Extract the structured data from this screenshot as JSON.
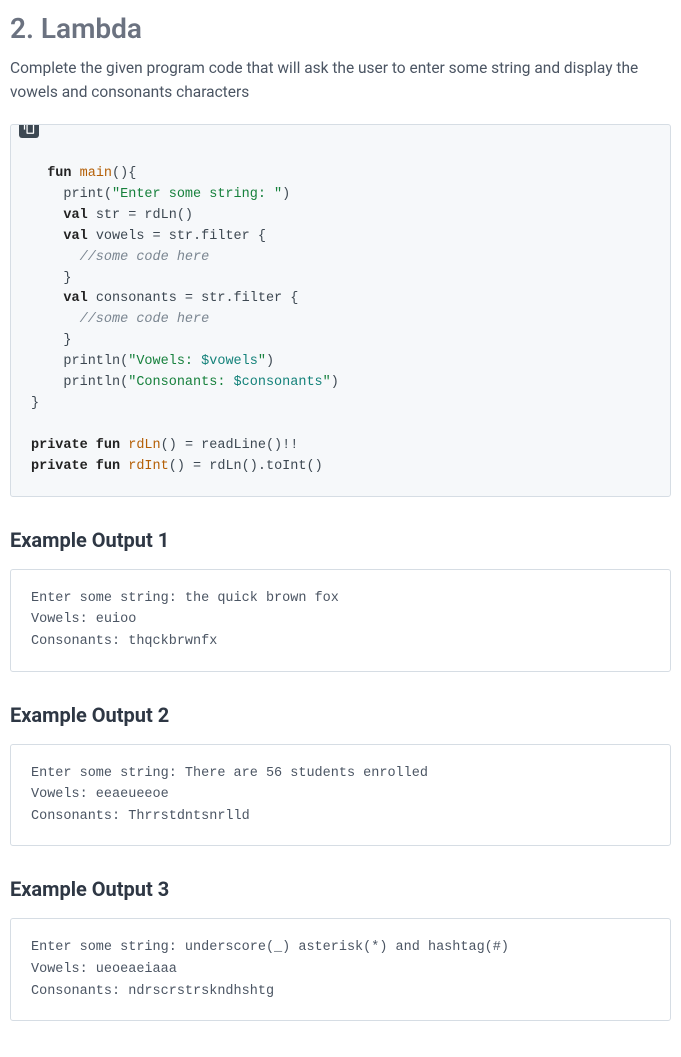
{
  "section": {
    "title": "2. Lambda",
    "description": "Complete the given program code that will ask the user to enter some string and display the vowels and consonants characters"
  },
  "code": {
    "line1_kw1": "fun",
    "line1_fn": "main",
    "line1_rest": "(){",
    "line2_indent": "    print(",
    "line2_str": "\"Enter some string: \"",
    "line2_end": ")",
    "line3": "    val str = rdLn()",
    "line4": "    val vowels = str.filter {",
    "line5_indent": "      ",
    "line5_comment": "//some code here",
    "line6": "    }",
    "line7": "    val consonants = str.filter {",
    "line8_indent": "      ",
    "line8_comment": "//some code here",
    "line9": "    }",
    "line10_indent": "    println(",
    "line10_str1": "\"Vowels: ",
    "line10_interp": "$vowels",
    "line10_str2": "\"",
    "line10_end": ")",
    "line11_indent": "    println(",
    "line11_str1": "\"Consonants: ",
    "line11_interp": "$consonants",
    "line11_str2": "\"",
    "line11_end": ")",
    "line12": "}",
    "blank": "",
    "line13_kw": "private fun",
    "line13_fn": "rdLn",
    "line13_rest": "() = readLine()!!",
    "line14_kw": "private fun",
    "line14_fn": "rdInt",
    "line14_rest": "() = rdLn().toInt()",
    "kw_val": "val",
    "kw_fun": "fun"
  },
  "examples": [
    {
      "title": "Example Output 1",
      "lines": "Enter some string: the quick brown fox\nVowels: euioo\nConsonants: thqckbrwnfx"
    },
    {
      "title": "Example Output 2",
      "lines": "Enter some string: There are 56 students enrolled\nVowels: eeaeueeoe\nConsonants: Thrrstdntsnrlld"
    },
    {
      "title": "Example Output 3",
      "lines": "Enter some string: underscore(_) asterisk(*) and hashtag(#)\nVowels: ueoeaeiaaa\nConsonants: ndrscrstrskndhshtg"
    }
  ]
}
